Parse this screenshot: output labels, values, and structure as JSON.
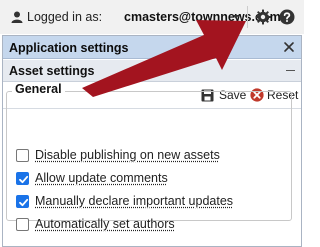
{
  "topbar": {
    "login_label": "Logged in as:",
    "username": "cmasters@townnews.com"
  },
  "panel": {
    "app_settings_title": "Application settings",
    "asset_settings_title": "Asset settings",
    "toolbar": {
      "save_label": "Save",
      "reset_label": "Reset"
    },
    "general": {
      "legend": "General",
      "options": [
        {
          "label": "Disable publishing on new assets",
          "checked": false
        },
        {
          "label": "Allow update comments",
          "checked": true
        },
        {
          "label": "Manually declare important updates",
          "checked": true
        },
        {
          "label": "Automatically set authors",
          "checked": false
        }
      ]
    }
  },
  "colors": {
    "arrow": "#a3141f",
    "app_header_bg": "#c5d7ed",
    "checkbox_checked": "#1a73e8",
    "reset_icon": "#c0392b"
  },
  "icons": [
    "user-icon",
    "gear-icon",
    "help-icon",
    "close-icon",
    "collapse-icon",
    "save-icon",
    "reset-icon"
  ]
}
